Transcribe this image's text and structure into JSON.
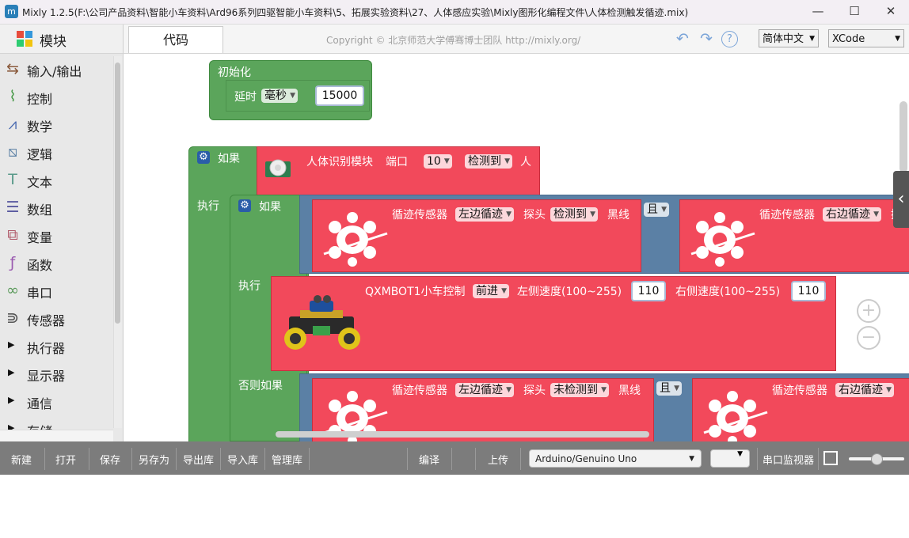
{
  "window": {
    "title": "Mixly 1.2.5(F:\\公司产品资料\\智能小车资料\\Ard96系列四驱智能小车资料\\5、拓展实验资料\\27、人体感应实验\\Mixly图形化编程文件\\人体检测触发循迹.mix)",
    "app_icon": "m",
    "min": "—",
    "max": "☐",
    "close": "✕"
  },
  "sidebar": {
    "header": "模块",
    "items": [
      {
        "label": "输入/输出",
        "icon": "io-icon",
        "glyph": "⇆",
        "color": "#8a5a3c"
      },
      {
        "label": "控制",
        "icon": "control-icon",
        "glyph": "⌇",
        "color": "#4a9a4a"
      },
      {
        "label": "数学",
        "icon": "math-icon",
        "glyph": "⩘",
        "color": "#4a6ab0"
      },
      {
        "label": "逻辑",
        "icon": "logic-icon",
        "glyph": "⧅",
        "color": "#5b80a5"
      },
      {
        "label": "文本",
        "icon": "text-icon",
        "glyph": "T",
        "color": "#5a9a8a"
      },
      {
        "label": "数组",
        "icon": "array-icon",
        "glyph": "☰",
        "color": "#5a5aa0"
      },
      {
        "label": "变量",
        "icon": "variable-icon",
        "glyph": "⧉",
        "color": "#b05a6a"
      },
      {
        "label": "函数",
        "icon": "function-icon",
        "glyph": "ƒ",
        "color": "#9a5ab0"
      },
      {
        "label": "串口",
        "icon": "serial-icon",
        "glyph": "∞",
        "color": "#5a9a5a"
      },
      {
        "label": "传感器",
        "icon": "sensor-icon",
        "glyph": "⋑",
        "color": "#555555"
      },
      {
        "label": "执行器",
        "icon": "expand-icon",
        "glyph": "▶"
      },
      {
        "label": "显示器",
        "icon": "expand-icon",
        "glyph": "▶"
      },
      {
        "label": "通信",
        "icon": "expand-icon",
        "glyph": "▶"
      },
      {
        "label": "存储",
        "icon": "expand-icon",
        "glyph": "▶"
      }
    ]
  },
  "toolbar": {
    "tab_code": "代码",
    "copyright": "Copyright © 北京师范大学傅骞博士团队 http://mixly.org/",
    "undo": "↶",
    "redo": "↷",
    "help": "?",
    "language": "简体中文",
    "theme": "XCode"
  },
  "blocks": {
    "setup": {
      "label": "初始化",
      "delay": "延时",
      "unit": "毫秒",
      "value": "15000"
    },
    "if_outer": {
      "if": "如果",
      "do": "执行",
      "sensor": "人体识别模块",
      "port_label": "端口",
      "port": "10",
      "state": "检测到",
      "suffix": "人"
    },
    "if_inner": {
      "if": "如果",
      "do": "执行",
      "elseif": "否则如果",
      "track_label": "循迹传感器",
      "left": "左边循迹",
      "right": "右边循迹",
      "probe": "探头",
      "detected": "检测到",
      "not_detected": "未检测到",
      "black": "黑线",
      "and": "且",
      "probe_cut": "探"
    },
    "car": {
      "label": "QXMBOT1小车控制",
      "dir": "前进",
      "left_speed": "左侧速度(100~255)",
      "left_val": "110",
      "right_speed": "右侧速度(100~255)",
      "right_val": "110"
    }
  },
  "bottom": {
    "buttons": [
      "新建",
      "打开",
      "保存",
      "另存为",
      "导出库",
      "导入库",
      "管理库"
    ],
    "compile": "编译",
    "upload": "上传",
    "board": "Arduino/Genuino Uno",
    "port": "",
    "serial_monitor": "串口监视器"
  },
  "colors": {
    "block_green": "#5ba55b",
    "block_red": "#f2495b",
    "block_blue": "#5b80a5",
    "bottom_bar": "#7c7c7c"
  }
}
